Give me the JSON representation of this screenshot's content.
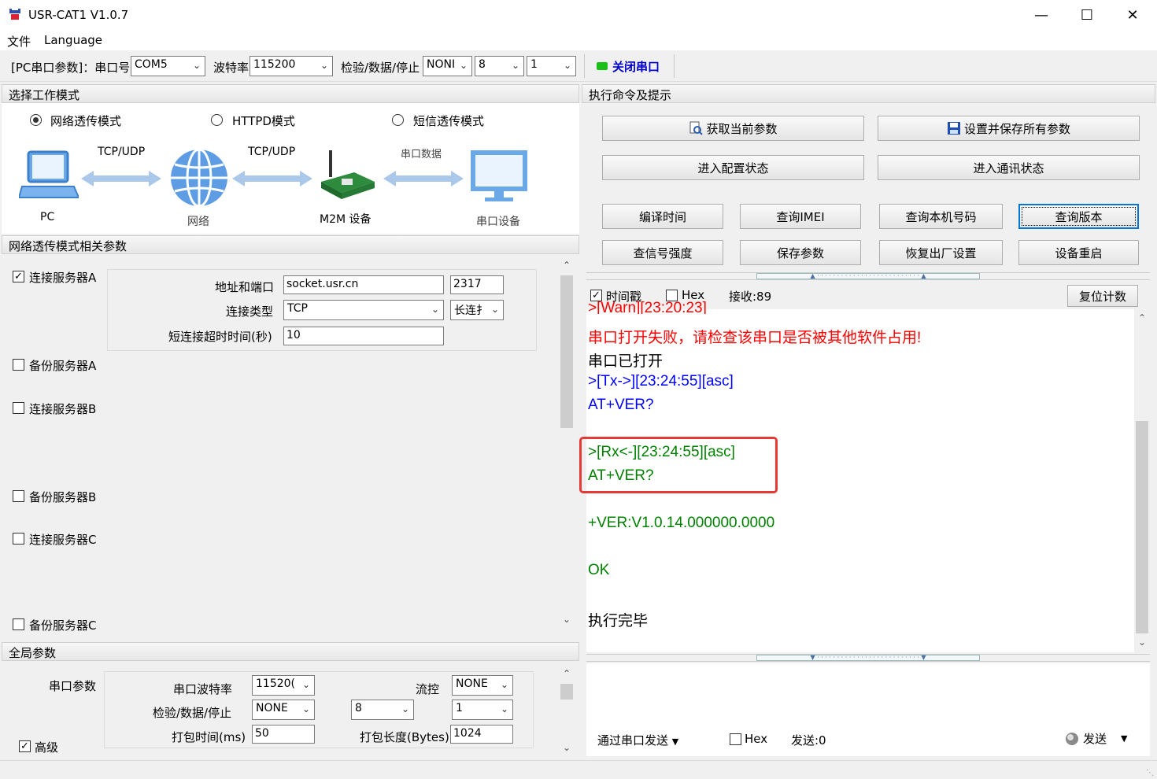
{
  "window": {
    "title": "USR-CAT1 V1.0.7"
  },
  "menu": {
    "file": "文件",
    "language": "Language"
  },
  "toolbar": {
    "prefix": "[PC串口参数]：串口号",
    "port": "COM5",
    "baud_label": "波特率",
    "baud": "115200",
    "check_label": "检验/数据/停止",
    "parity": "NONI",
    "data_bits": "8",
    "stop_bits": "1",
    "close_port": "关闭串口",
    "led_color": "#18c018"
  },
  "mode": {
    "header": "选择工作模式",
    "options": [
      "网络透传模式",
      "HTTPD模式",
      "短信透传模式"
    ],
    "selected": 0,
    "diagram": {
      "pc": "PC",
      "proto1": "TCP/UDP",
      "network": "网络",
      "proto2": "TCP/UDP",
      "m2m": "M2M 设备",
      "serial_data": "串口数据",
      "serial_device": "串口设备"
    }
  },
  "net_params": {
    "header": "网络透传模式相关参数",
    "server_a": {
      "label": "连接服务器A",
      "checked": true,
      "addr_label": "地址和端口",
      "addr": "socket.usr.cn",
      "port": "2317",
      "type_label": "连接类型",
      "type": "TCP",
      "conn_mode": "长连扌",
      "timeout_label": "短连接超时时间(秒)",
      "timeout": "10"
    },
    "servers": [
      "备份服务器A",
      "连接服务器B",
      "备份服务器B",
      "连接服务器C",
      "备份服务器C"
    ]
  },
  "global": {
    "header": "全局参数",
    "serial_label": "串口参数",
    "baud_label": "串口波特率",
    "baud": "11520(",
    "flow_label": "流控",
    "flow": "NONE",
    "check_label": "检验/数据/停止",
    "parity": "NONE",
    "data_bits": "8",
    "stop_bits": "1",
    "pack_time_label": "打包时间(ms)",
    "pack_time": "50",
    "pack_len_label": "打包长度(Bytes)",
    "pack_len": "1024",
    "advanced": "高级"
  },
  "commands": {
    "header": "执行命令及提示",
    "get_params": "获取当前参数",
    "save_all": "设置并保存所有参数",
    "enter_config": "进入配置状态",
    "enter_comm": "进入通讯状态",
    "row3": [
      "编译时间",
      "查询IMEI",
      "查询本机号码",
      "查询版本"
    ],
    "row4": [
      "查信号强度",
      "保存参数",
      "恢复出厂设置",
      "设备重启"
    ]
  },
  "log": {
    "timestamp": "时间戳",
    "hex": "Hex",
    "recv": "接收:89",
    "reset": "复位计数",
    "lines": [
      ">[Warn][23:20:23]",
      "串口打开失败，请检查该串口是否被其他软件占用!",
      "串口已打开",
      ">[Tx->][23:24:55][asc]",
      "AT+VER?",
      ">[Rx<-][23:24:55][asc]",
      "AT+VER?",
      "+VER:V1.0.14.000000.0000",
      "OK",
      "执行完毕"
    ],
    "highlight_color": "#e53935"
  },
  "send": {
    "via": "通过串口发送",
    "hex": "Hex",
    "sent": "发送:0",
    "send_btn": "发送"
  }
}
